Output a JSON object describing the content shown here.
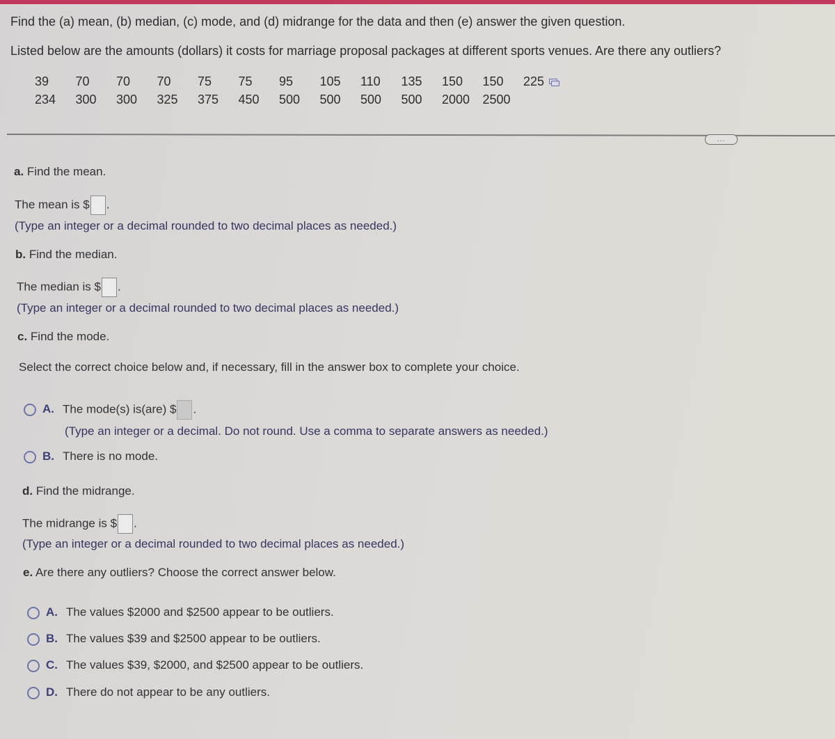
{
  "header": {
    "instructions": "Find the (a) mean, (b) median, (c) mode, and (d) midrange for the data and then (e) answer the given question.",
    "problem": "Listed below are the amounts (dollars) it costs for marriage proposal packages at different sports venues. Are there any outliers?"
  },
  "data_values": {
    "row1": [
      "39",
      "70",
      "70",
      "70",
      "75",
      "75",
      "95",
      "105",
      "110",
      "135",
      "150",
      "150",
      "225"
    ],
    "row2": [
      "234",
      "300",
      "300",
      "325",
      "375",
      "450",
      "500",
      "500",
      "500",
      "500",
      "2000",
      "2500"
    ]
  },
  "more_button": "...",
  "part_a": {
    "heading_letter": "a.",
    "heading_text": " Find the mean.",
    "prompt_before": "The mean is $",
    "prompt_after": ".",
    "hint": "(Type an integer or a decimal rounded to two decimal places as needed.)"
  },
  "part_b": {
    "heading_letter": "b.",
    "heading_text": " Find the median.",
    "prompt_before": "The median is $",
    "prompt_after": ".",
    "hint": "(Type an integer or a decimal rounded to two decimal places as needed.)"
  },
  "part_c": {
    "heading_letter": "c.",
    "heading_text": " Find the mode.",
    "instruction": "Select the correct choice below and, if necessary, fill in the answer box to complete your choice.",
    "options": [
      {
        "letter": "A.",
        "text_before": "The mode(s) is(are) $",
        "text_after": ".",
        "hint": "(Type an integer or a decimal. Do not round. Use a comma to separate answers as needed.)"
      },
      {
        "letter": "B.",
        "text": "There is no mode."
      }
    ]
  },
  "part_d": {
    "heading_letter": "d.",
    "heading_text": " Find the midrange.",
    "prompt_before": "The midrange is $",
    "prompt_after": ".",
    "hint": "(Type an integer or a decimal rounded to two decimal places as needed.)"
  },
  "part_e": {
    "heading_letter": "e.",
    "heading_text": " Are there any outliers? Choose the correct answer below.",
    "options": [
      {
        "letter": "A.",
        "text": "The values $2000 and $2500 appear to be outliers."
      },
      {
        "letter": "B.",
        "text": "The values $39 and $2500 appear to be outliers."
      },
      {
        "letter": "C.",
        "text": "The values $39, $2000, and $2500 appear to be outliers."
      },
      {
        "letter": "D.",
        "text": "There do not appear to be any outliers."
      }
    ]
  },
  "colors": {
    "top_bar": "#c0395a",
    "radio_accent": "#6d75a6",
    "hint_text": "#363660"
  }
}
